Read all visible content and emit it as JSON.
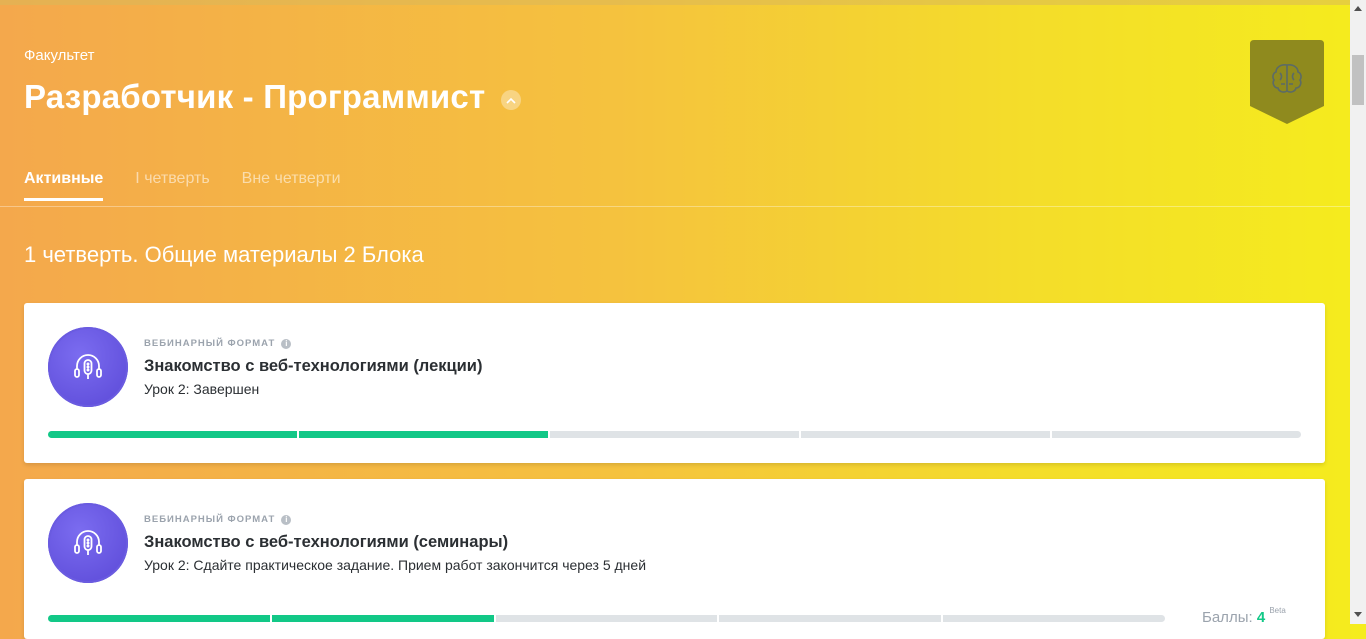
{
  "header": {
    "faculty_label": "Факультет",
    "title": "Разработчик - Программист",
    "collapse_icon": "chevron-up-icon",
    "badge_icon": "brain-icon"
  },
  "tabs": [
    {
      "label": "Активные",
      "active": true
    },
    {
      "label": "I четверть",
      "active": false
    },
    {
      "label": "Вне четверти",
      "active": false
    }
  ],
  "section": {
    "title": "1 четверть. Общие материалы 2 Блока"
  },
  "courses": [
    {
      "format": "ВЕБИНАРНЫЙ ФОРМАТ",
      "title": "Знакомство с веб-технологиями (лекции)",
      "status": "Урок 2: Завершен",
      "icon": "microphone-headphones-icon",
      "progress_done": 2,
      "progress_total": 5
    },
    {
      "format": "ВЕБИНАРНЫЙ ФОРМАТ",
      "title": "Знакомство с веб-технологиями (семинары)",
      "status": "Урок 2: Сдайте практическое задание. Прием работ закончится через 5 дней",
      "icon": "microphone-headphones-icon",
      "progress_done": 2,
      "progress_total": 5,
      "points_label": "Баллы:",
      "points_value": "4",
      "points_beta": "Beta"
    }
  ],
  "colors": {
    "accent_green": "#12c887",
    "avatar_purple": "#5a48d6",
    "gradient_start": "#f4a84c",
    "gradient_end": "#f5ec1d"
  }
}
